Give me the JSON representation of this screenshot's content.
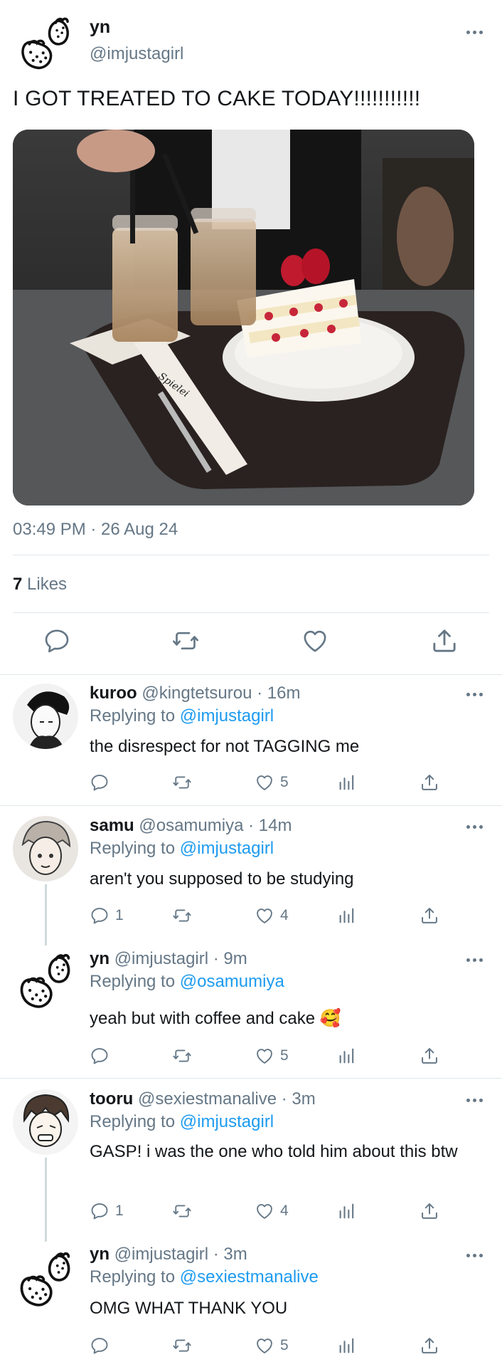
{
  "main_tweet": {
    "name": "yn",
    "handle": "@imjustagirl",
    "text": "I GOT TREATED TO CAKE TODAY!!!!!!!!!!!",
    "timestamp": "03:49 PM · 26 Aug 24",
    "likes_count": "7",
    "likes_label": "Likes",
    "image_logo_text": "Spielei"
  },
  "replies": [
    {
      "name": "kuroo",
      "handle": "@kingtetsurou",
      "age": "· 16m",
      "replying_prefix": "Replying to",
      "replying_to": "@imjustagirl",
      "text": "the disrespect for not TAGGING me",
      "reply_count": "",
      "like_count": "5"
    },
    {
      "name": "samu",
      "handle": "@osamumiya",
      "age": "· 14m",
      "replying_prefix": "Replying to",
      "replying_to": "@imjustagirl",
      "text": "aren't you supposed to be studying",
      "reply_count": "1",
      "like_count": "4"
    },
    {
      "name": "yn",
      "handle": "@imjustagirl",
      "age": "· 9m",
      "replying_prefix": "Replying to",
      "replying_to": "@osamumiya",
      "text": "yeah but with coffee and cake 🥰",
      "reply_count": "",
      "like_count": "5"
    },
    {
      "name": "tooru",
      "handle": "@sexiestmanalive",
      "age": "· 3m",
      "replying_prefix": "Replying to",
      "replying_to": "@imjustagirl",
      "text": "GASP! i was the one who told him about this btw",
      "reply_count": "1",
      "like_count": "4"
    },
    {
      "name": "yn",
      "handle": "@imjustagirl",
      "age": "· 3m",
      "replying_prefix": "Replying to",
      "replying_to": "@sexiestmanalive",
      "text": "OMG WHAT THANK YOU",
      "reply_count": "",
      "like_count": "5"
    }
  ],
  "icons": {
    "reply": "reply-icon",
    "retweet": "retweet-icon",
    "like": "heart-icon",
    "views": "views-icon",
    "share": "share-icon",
    "more": "more-icon"
  },
  "colors": {
    "link": "#1d9bf0",
    "muted": "#657786",
    "divider": "#e1e8ed",
    "text": "#14171a"
  }
}
